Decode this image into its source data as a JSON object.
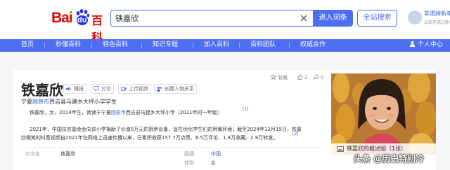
{
  "header": {
    "logo_bai": "Bai",
    "logo_du": "du",
    "logo_baike": "百科",
    "search_value": "铁嘉欣",
    "enter_entry_label": "进入词条",
    "site_search_label": "全站搜索",
    "promo_title": "非遗跨新年",
    "promo_sub": "云南非遗过新年",
    "accent": "#4e6ef2"
  },
  "nav": {
    "items": [
      "首页",
      "秒懂百科",
      "特色百科",
      "知识专题",
      "加入百科",
      "百科团队",
      "权威合作"
    ],
    "user_center": "个人中心"
  },
  "article": {
    "title": "铁嘉欣",
    "tools": [
      "播报",
      "讨论",
      "上传视频",
      "创建人物关系"
    ],
    "right_tools": {
      "collect_label": "收藏",
      "like_count": "2",
      "share_count": "0"
    },
    "subtitle_pre": "宁夏",
    "subtitle_link": "固原市",
    "subtitle_post": "西吉县马建乡大坪小学学生",
    "intro_pre": "铁嘉欣，女，2014年生，就读于宁夏",
    "intro_link": "固原市",
    "intro_post": "西吉县马建乡大坪小学（2021年时一年级）",
    "intro_ref": "[1]",
    "para2_line1": "2021年，中国扶贫基金会向该小学捐助了价值5万元的厨房设备，旨在优化学生们的用餐环境；截至2024年12月15日，铁嘉",
    "para2_line2": "欣微笑的抖音视频自2021年在网络上迅速传播以来，已累积收获157.7万点赞、6.5万评论、1.8万收藏、2.9万转发。",
    "para2_ref": "[2]",
    "info": [
      {
        "key": "中文名",
        "value": "铁嘉欣"
      },
      {
        "key": "国籍",
        "value": "中国"
      },
      {
        "key": "",
        "value": ""
      },
      {
        "key": "性别",
        "value": "女"
      }
    ]
  },
  "photo": {
    "caption": "铁嘉欣的概述图（1张）"
  },
  "watermark": "头条 @历史特别冷"
}
